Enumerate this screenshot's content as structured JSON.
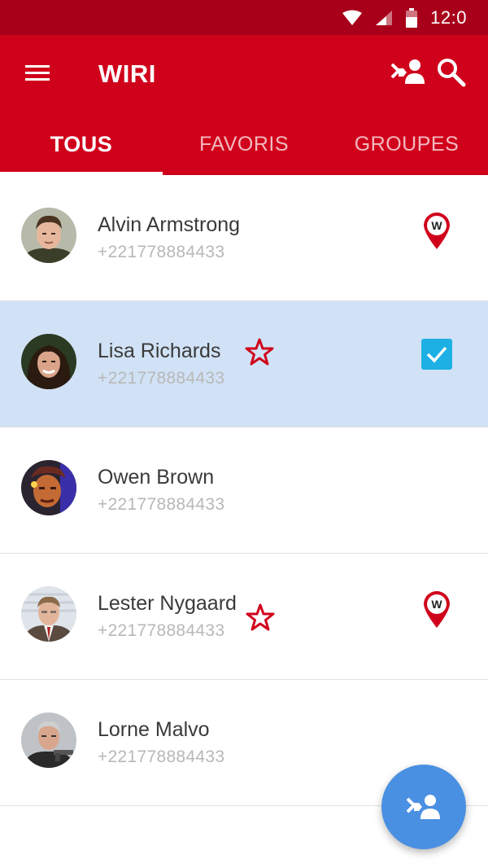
{
  "status_bar": {
    "time": "12:0"
  },
  "app_bar": {
    "title": "WIRI"
  },
  "tabs": [
    {
      "label": "TOUS",
      "active": true
    },
    {
      "label": "FAVORIS",
      "active": false
    },
    {
      "label": "GROUPES",
      "active": false
    }
  ],
  "contacts": [
    {
      "name": "Alvin Armstrong",
      "phone": "+221778884433",
      "favorite": false,
      "wiri_user": true,
      "selected": false
    },
    {
      "name": "Lisa Richards",
      "phone": "+221778884433",
      "favorite": true,
      "wiri_user": false,
      "selected": true
    },
    {
      "name": "Owen Brown",
      "phone": "+221778884433",
      "favorite": false,
      "wiri_user": false,
      "selected": false
    },
    {
      "name": "Lester Nygaard",
      "phone": "+221778884433",
      "favorite": true,
      "wiri_user": true,
      "selected": false
    },
    {
      "name": "Lorne Malvo",
      "phone": "+221778884433",
      "favorite": false,
      "wiri_user": false,
      "selected": false
    }
  ],
  "icons": {
    "menu": "menu-icon",
    "add_user": "add-contact-icon",
    "search": "search-icon",
    "favorite": "star-outline-icon",
    "wiri_pin": "wiri-location-pin-icon",
    "check": "checkbox-checked-icon",
    "fab": "add-contact-icon"
  },
  "colors": {
    "primary": "#d0021b",
    "status_bar": "#a8001a",
    "selected_row": "#d1e2f6",
    "checkbox": "#1db0e4",
    "fab": "#4a90e2",
    "phone_text": "#b8b8b8"
  }
}
